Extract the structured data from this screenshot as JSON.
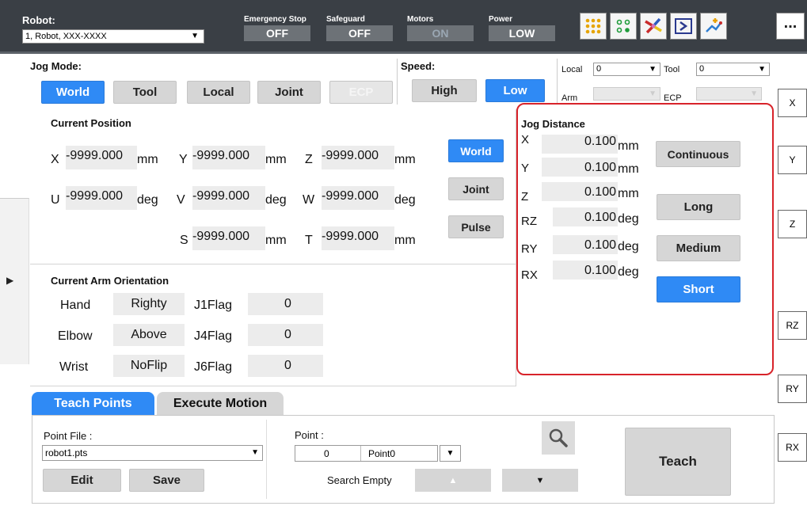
{
  "topbar": {
    "robot_label": "Robot:",
    "robot_value": "1, Robot, XXX-XXXX",
    "emergency_label": "Emergency Stop",
    "emergency_value": "OFF",
    "safeguard_label": "Safeguard",
    "safeguard_value": "OFF",
    "motors_label": "Motors",
    "motors_value": "ON",
    "power_label": "Power",
    "power_value": "LOW",
    "more_label": "..."
  },
  "jog": {
    "mode_label": "Jog Mode:",
    "modes": [
      "World",
      "Tool",
      "Local",
      "Joint",
      "ECP"
    ],
    "speed_label": "Speed:",
    "speeds": [
      "High",
      "Low"
    ]
  },
  "frames": {
    "local_label": "Local",
    "local_value": "0",
    "tool_label": "Tool",
    "tool_value": "0",
    "arm_label": "Arm",
    "ecp_label": "ECP"
  },
  "position": {
    "title": "Current Position",
    "x_label": "X",
    "x_value": "-9999.000",
    "x_unit": "mm",
    "y_label": "Y",
    "y_value": "-9999.000",
    "y_unit": "mm",
    "z_label": "Z",
    "z_value": "-9999.000",
    "z_unit": "mm",
    "u_label": "U",
    "u_value": "-9999.000",
    "u_unit": "deg",
    "v_label": "V",
    "v_value": "-9999.000",
    "v_unit": "deg",
    "w_label": "W",
    "w_value": "-9999.000",
    "w_unit": "deg",
    "s_label": "S",
    "s_value": "-9999.000",
    "s_unit": "mm",
    "t_label": "T",
    "t_value": "-9999.000",
    "t_unit": "mm",
    "display_buttons": [
      "World",
      "Joint",
      "Pulse"
    ]
  },
  "orientation": {
    "title": "Current Arm Orientation",
    "rows": [
      {
        "label": "Hand",
        "value": "Righty",
        "flag_label": "J1Flag",
        "flag_value": "0"
      },
      {
        "label": "Elbow",
        "value": "Above",
        "flag_label": "J4Flag",
        "flag_value": "0"
      },
      {
        "label": "Wrist",
        "value": "NoFlip",
        "flag_label": "J6Flag",
        "flag_value": "0"
      }
    ]
  },
  "jog_distance": {
    "title": "Jog Distance",
    "rows": [
      {
        "label": "X",
        "value": "0.100",
        "unit": "mm"
      },
      {
        "label": "Y",
        "value": "0.100",
        "unit": "mm"
      },
      {
        "label": "Z",
        "value": "0.100",
        "unit": "mm"
      },
      {
        "label": "RZ",
        "value": "0.100",
        "unit": "deg"
      },
      {
        "label": "RY",
        "value": "0.100",
        "unit": "deg"
      },
      {
        "label": "RX",
        "value": "0.100",
        "unit": "deg"
      }
    ],
    "buttons": [
      "Continuous",
      "Long",
      "Medium",
      "Short"
    ],
    "highlight_color": "#d8232a"
  },
  "side_jog": [
    "X",
    "Y",
    "Z",
    "RZ",
    "RY",
    "RX"
  ],
  "tabs": [
    "Teach Points",
    "Execute Motion"
  ],
  "teach": {
    "point_file_label": "Point File :",
    "point_file_value": "robot1.pts",
    "point_label": "Point :",
    "point_number": "0",
    "point_name": "Point0",
    "edit_label": "Edit",
    "save_label": "Save",
    "search_empty_label": "Search Empty",
    "teach_label": "Teach"
  },
  "colors": {
    "accent": "#2f8af5",
    "topbar": "#3a3f45",
    "button": "#d6d6d6"
  }
}
